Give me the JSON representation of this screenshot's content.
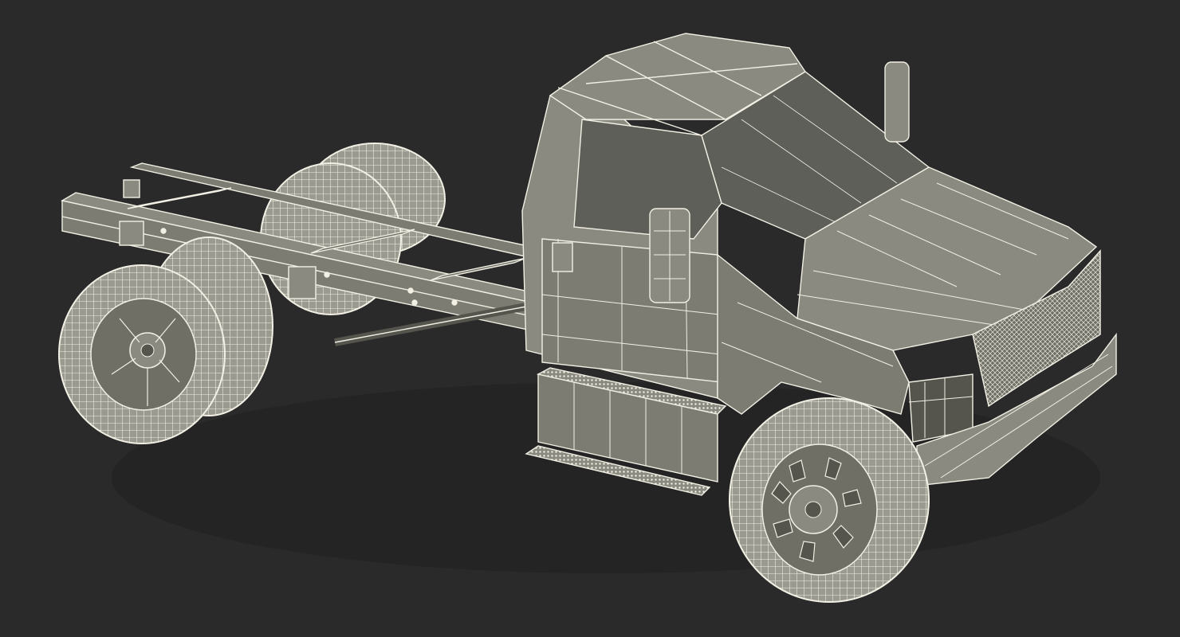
{
  "scene": {
    "subject": "truck-chassis-cab-wireframe",
    "colors": {
      "background": "#2a2a2a",
      "body_fill": "#8a8a80",
      "body_shade": "#6f6f66",
      "body_dark": "#55554e",
      "frame_fill": "#7c7c73",
      "tire_fill": "#9a9a90",
      "wire": "#f2f0e4",
      "glass": "#5f5f59",
      "shadow": "#1f1f1f"
    }
  }
}
